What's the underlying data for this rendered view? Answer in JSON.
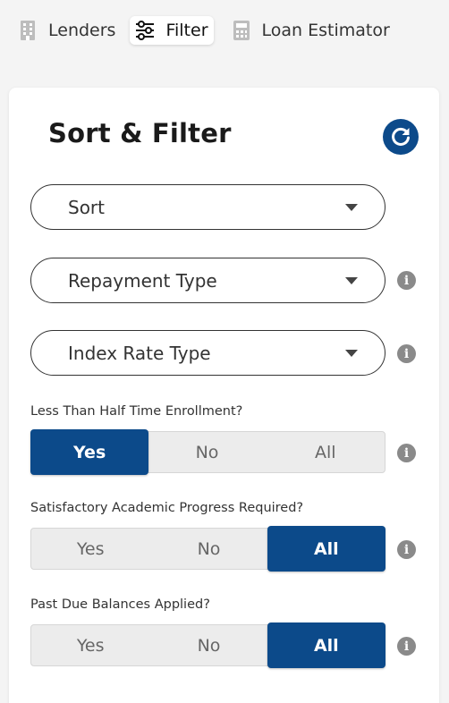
{
  "tabs": [
    {
      "label": "Lenders",
      "icon": "building-icon"
    },
    {
      "label": "Filter",
      "icon": "sliders-icon"
    },
    {
      "label": "Loan Estimator",
      "icon": "calculator-icon"
    }
  ],
  "card": {
    "title": "Sort & Filter"
  },
  "dropdowns": {
    "sort": "Sort",
    "repayment": "Repayment Type",
    "index_rate": "Index Rate Type"
  },
  "questions": [
    {
      "label": "Less Than Half Time Enrollment?",
      "options": [
        "Yes",
        "No",
        "All"
      ],
      "selected": "Yes"
    },
    {
      "label": "Satisfactory Academic Progress Required?",
      "options": [
        "Yes",
        "No",
        "All"
      ],
      "selected": "All"
    },
    {
      "label": "Past Due Balances Applied?",
      "options": [
        "Yes",
        "No",
        "All"
      ],
      "selected": "All"
    }
  ],
  "colors": {
    "accent": "#0c4a8a",
    "info": "#8a8a8a"
  }
}
